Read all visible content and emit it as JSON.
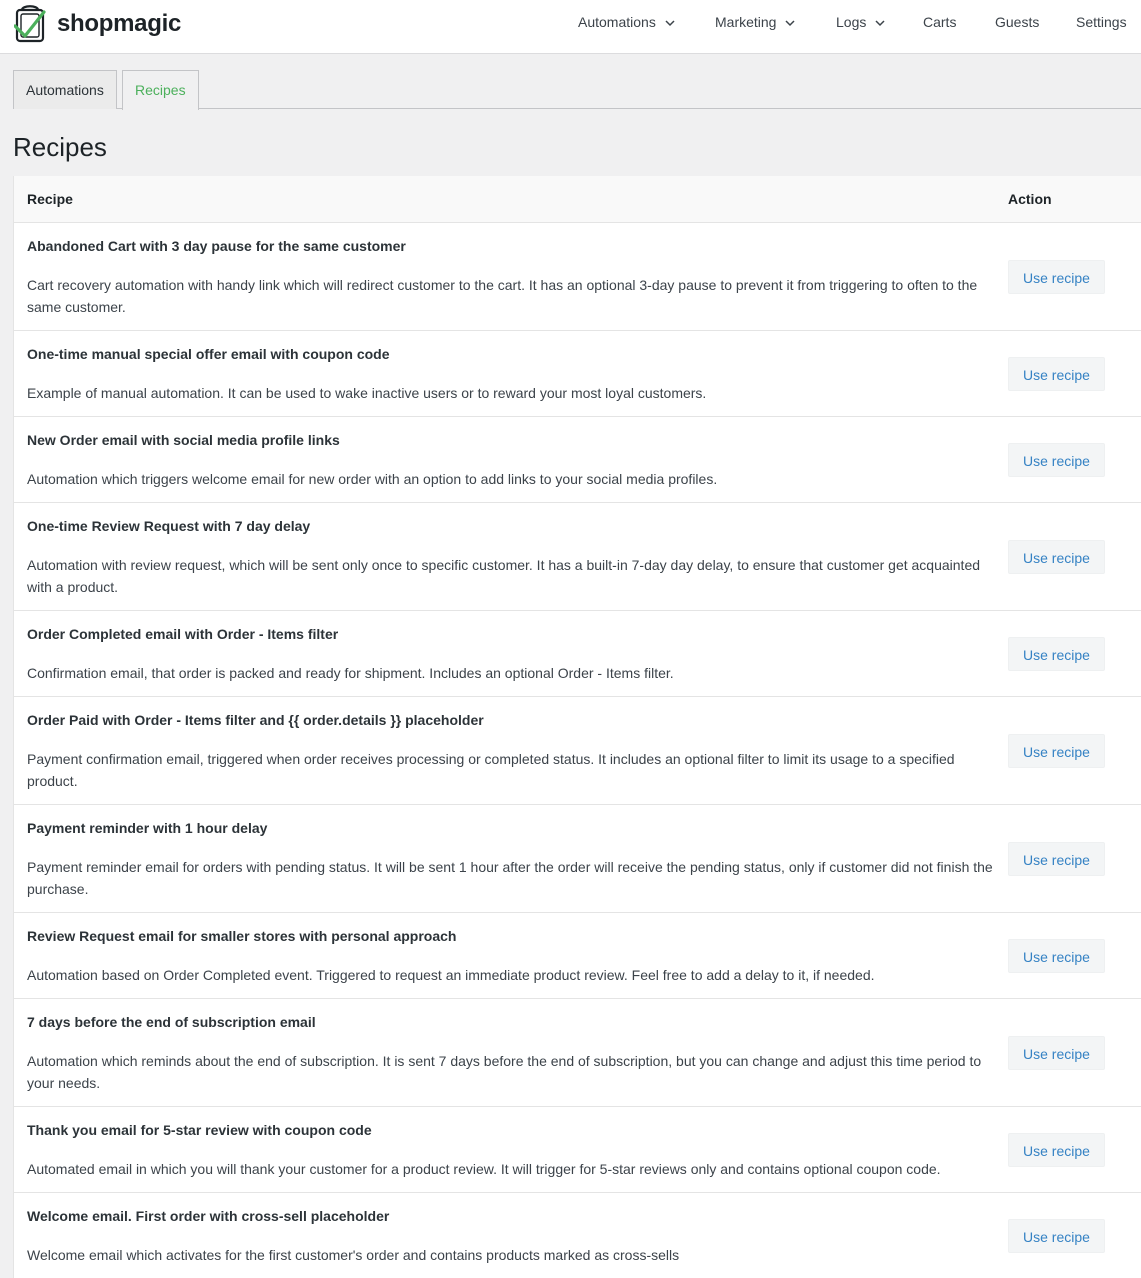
{
  "header": {
    "logo_text": "shopmagic",
    "nav": [
      {
        "label": "Automations",
        "has_dropdown": true
      },
      {
        "label": "Marketing",
        "has_dropdown": true
      },
      {
        "label": "Logs",
        "has_dropdown": true
      },
      {
        "label": "Carts",
        "has_dropdown": false
      },
      {
        "label": "Guests",
        "has_dropdown": false
      },
      {
        "label": "Settings",
        "has_dropdown": false
      }
    ]
  },
  "tabs": [
    {
      "label": "Automations",
      "active": false
    },
    {
      "label": "Recipes",
      "active": true
    }
  ],
  "page_title": "Recipes",
  "table": {
    "columns": {
      "recipe": "Recipe",
      "action": "Action"
    },
    "button_label": "Use recipe",
    "rows": [
      {
        "title": "Abandoned Cart with 3 day pause for the same customer",
        "description": "Cart recovery automation with handy link which will redirect customer to the cart. It has an optional 3-day pause to prevent it from triggering to often to the same customer."
      },
      {
        "title": "One-time manual special offer email with coupon code",
        "description": "Example of manual automation. It can be used to wake inactive users or to reward your most loyal customers."
      },
      {
        "title": "New Order email with social media profile links",
        "description": "Automation which triggers welcome email for new order with an option to add links to your social media profiles."
      },
      {
        "title": "One-time Review Request with 7 day delay",
        "description": "Automation with review request, which will be sent only once to specific customer. It has a built-in 7-day day delay, to ensure that customer get acquainted with a product."
      },
      {
        "title": "Order Completed email with Order - Items filter",
        "description": "Confirmation email, that order is packed and ready for shipment. Includes an optional Order - Items filter."
      },
      {
        "title": "Order Paid with Order - Items filter and {{ order.details }} placeholder",
        "description": "Payment confirmation email, triggered when order receives processing or completed status. It includes an optional filter to limit its usage to a specified product."
      },
      {
        "title": "Payment reminder with 1 hour delay",
        "description": "Payment reminder email for orders with pending status. It will be sent 1 hour after the order will receive the pending status, only if customer did not finish the purchase."
      },
      {
        "title": "Review Request email for smaller stores with personal approach",
        "description": "Automation based on Order Completed event. Triggered to request an immediate product review. Feel free to add a delay to it, if needed."
      },
      {
        "title": "7 days before the end of subscription email",
        "description": "Automation which reminds about the end of subscription. It is sent 7 days before the end of subscription, but you can change and adjust this time period to your needs."
      },
      {
        "title": "Thank you email for 5-star review with coupon code",
        "description": "Automated email in which you will thank your customer for a product review. It will trigger for 5-star reviews only and contains optional coupon code."
      },
      {
        "title": "Welcome email. First order with cross-sell placeholder",
        "description": "Welcome email which activates for the first customer's order and contains products marked as cross-sells"
      }
    ]
  },
  "colors": {
    "accent_green": "#4cb05c",
    "link_blue": "#3582c4",
    "background": "#f0f0f1"
  }
}
